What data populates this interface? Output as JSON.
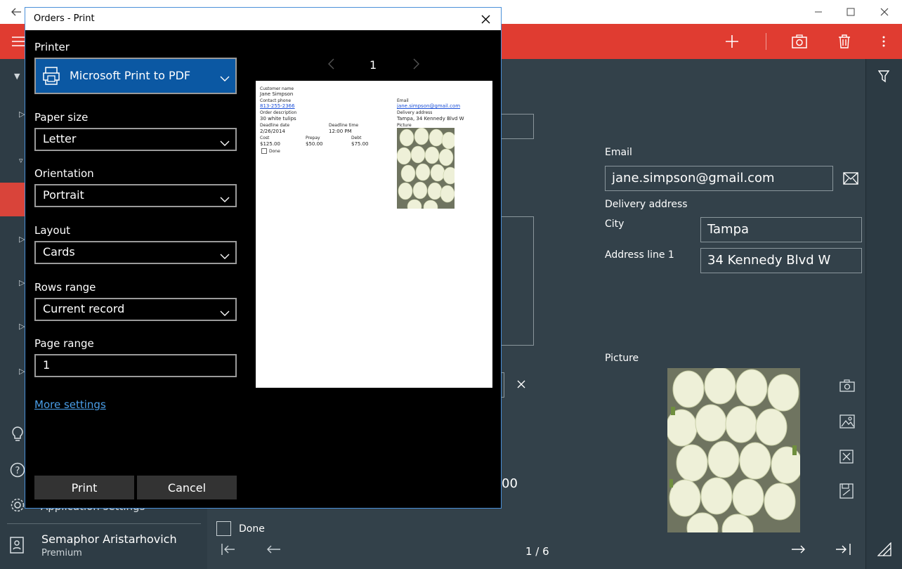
{
  "app": {
    "toolbar": {
      "icons": [
        "add-icon",
        "camera-icon",
        "delete-icon",
        "more-icon"
      ]
    },
    "sidebar": {
      "app_settings": "Application settings",
      "user_name": "Semaphor Aristarhovich",
      "user_plan": "Premium"
    },
    "form": {
      "email_label": "Email",
      "email_value": "jane.simpson@gmail.com",
      "delivery_label": "Delivery address",
      "city_label": "City",
      "city_value": "Tampa",
      "address_label": "Address line 1",
      "address_value": "34 Kennedy Blvd W",
      "picture_label": "Picture",
      "done_label": "Done",
      "partial_value": "00"
    },
    "pager": {
      "text": "1 / 6"
    }
  },
  "dialog": {
    "title": "Orders - Print",
    "printer_label": "Printer",
    "printer_value": "Microsoft Print to PDF",
    "paper_label": "Paper size",
    "paper_value": "Letter",
    "orientation_label": "Orientation",
    "orientation_value": "Portrait",
    "layout_label": "Layout",
    "layout_value": "Cards",
    "rows_label": "Rows range",
    "rows_value": "Current record",
    "pagerange_label": "Page range",
    "pagerange_value": "1",
    "more_settings": "More settings",
    "print_button": "Print",
    "cancel_button": "Cancel",
    "preview_page_number": "1",
    "preview": {
      "customer_name_label": "Customer name",
      "customer_name": "Jane Simpson",
      "contact_phone_label": "Contact phone",
      "contact_phone": "813-255-2366",
      "email_label": "Email",
      "email": "jane.simpson@gmail.com",
      "order_desc_label": "Order description",
      "order_desc": "30 white tulips",
      "delivery_label": "Delivery address",
      "delivery": "Tampa, 34 Kennedy Blvd W",
      "deadline_date_label": "Deadline date",
      "deadline_date": "2/26/2014",
      "deadline_time_label": "Deadline time",
      "deadline_time": "12:00 PM",
      "picture_label": "Picture",
      "cost_label": "Cost",
      "cost": "$125.00",
      "prepay_label": "Prepay",
      "prepay": "$50.00",
      "debt_label": "Debt",
      "debt": "$75.00",
      "done_label": "Done"
    }
  }
}
